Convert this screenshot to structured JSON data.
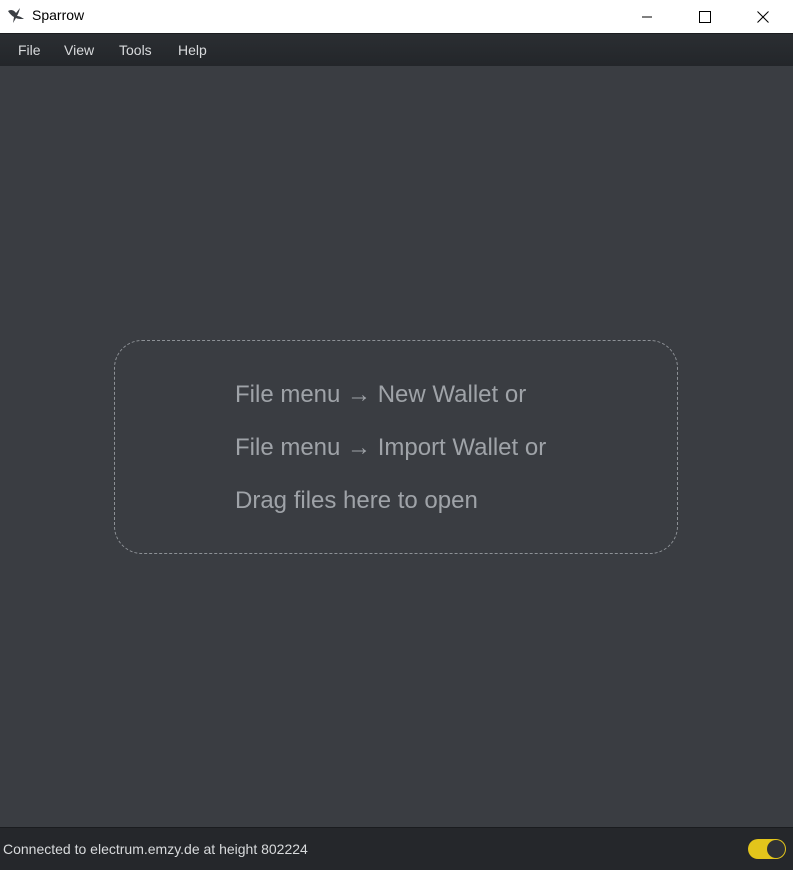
{
  "window": {
    "title": "Sparrow",
    "icon": "sparrow-bird-icon",
    "controls": [
      "minimize-icon",
      "maximize-icon",
      "close-icon"
    ]
  },
  "menu": {
    "items": [
      "File",
      "View",
      "Tools",
      "Help"
    ]
  },
  "dropzone": {
    "lines": [
      "File menu → New Wallet or",
      "File menu → Import Wallet or",
      "Drag files here to open"
    ]
  },
  "status": {
    "text": "Connected to electrum.emzy.de at height 802224",
    "toggle_on": true,
    "toggle_color": "#e3c51b"
  },
  "colors": {
    "background": "#3a3d42",
    "menubar": "#272a2e",
    "hint_text": "#9fa3a8"
  }
}
